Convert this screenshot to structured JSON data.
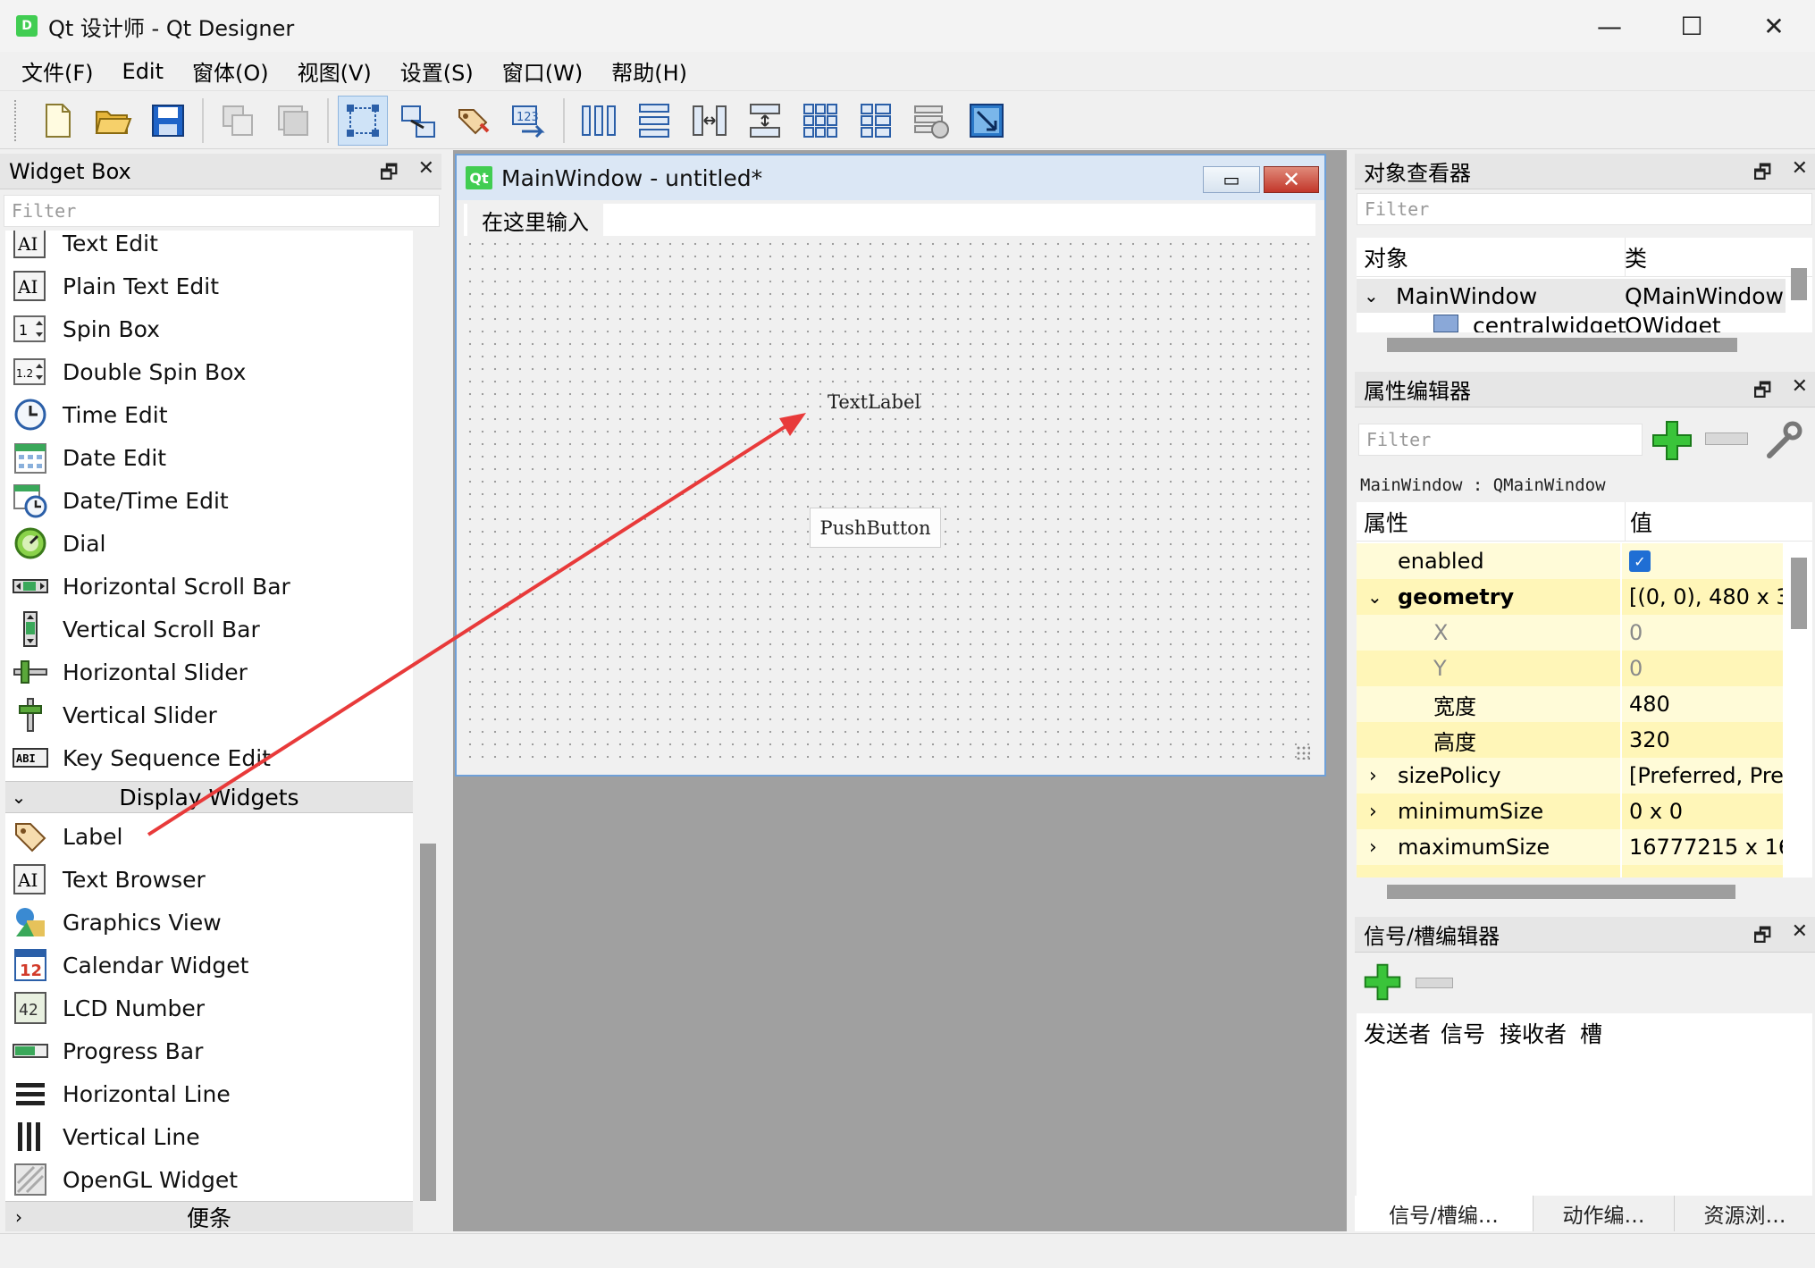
{
  "window": {
    "app_icon_letter": "D",
    "title": "Qt 设计师 - Qt Designer",
    "minimize": "—",
    "maximize": "☐",
    "close": "✕"
  },
  "menu": [
    "文件(F)",
    "Edit",
    "窗体(O)",
    "视图(V)",
    "设置(S)",
    "窗口(W)",
    "帮助(H)"
  ],
  "widget_box": {
    "title": "Widget Box",
    "filter_placeholder": "Filter",
    "items_input": [
      "Text Edit",
      "Plain Text Edit",
      "Spin Box",
      "Double Spin Box",
      "Time Edit",
      "Date Edit",
      "Date/Time Edit",
      "Dial",
      "Horizontal Scroll Bar",
      "Vertical Scroll Bar",
      "Horizontal Slider",
      "Vertical Slider",
      "Key Sequence Edit"
    ],
    "category_display": "Display Widgets",
    "items_display": [
      "Label",
      "Text Browser",
      "Graphics View",
      "Calendar Widget",
      "LCD Number",
      "Progress Bar",
      "Horizontal Line",
      "Vertical Line",
      "OpenGL Widget"
    ],
    "category_next": "便条",
    "icon_labels": {
      "ai": "AI",
      "spin": "1",
      "dspin": "1.2",
      "calendar": "12",
      "lcd": "42",
      "keyseq": "ABI"
    }
  },
  "form_window": {
    "badge": "Qt",
    "title": "MainWindow - untitled*",
    "min_glyph": "▭",
    "close_glyph": "✕",
    "menu_placeholder": "在这里输入",
    "text_label": "TextLabel",
    "push_button": "PushButton"
  },
  "object_inspector": {
    "title": "对象查看器",
    "filter_placeholder": "Filter",
    "col_object": "对象",
    "col_class": "类",
    "rows": [
      {
        "name": "MainWindow",
        "class": "QMainWindow"
      },
      {
        "name": "centralwidget",
        "class": "QWidget"
      }
    ]
  },
  "property_editor": {
    "title": "属性编辑器",
    "filter_placeholder": "Filter",
    "object_line": "MainWindow : QMainWindow",
    "col_property": "属性",
    "col_value": "值",
    "rows": [
      {
        "name": "enabled",
        "value": ""
      },
      {
        "name": "geometry",
        "value": "[(0, 0), 480 x 3..."
      },
      {
        "name": "X",
        "value": "0"
      },
      {
        "name": "Y",
        "value": "0"
      },
      {
        "name": "宽度",
        "value": "480"
      },
      {
        "name": "高度",
        "value": "320"
      },
      {
        "name": "sizePolicy",
        "value": "[Preferred, Pre..."
      },
      {
        "name": "minimumSize",
        "value": "0 x 0"
      },
      {
        "name": "maximumSize",
        "value": "16777215 x 16..."
      }
    ],
    "check_glyph": "✓"
  },
  "signal_slot_editor": {
    "title": "信号/槽编辑器",
    "columns": [
      "发送者",
      "信号",
      "接收者",
      "槽"
    ]
  },
  "bottom_tabs": [
    "信号/槽编…",
    "动作编…",
    "资源浏…"
  ],
  "dock_glyphs": {
    "float": "🗗",
    "close": "✕"
  },
  "colors": {
    "accent": "#41cd52",
    "selection": "#cfe3f7",
    "property_yellow": "#fff6b8",
    "arrow": "#e83a3a"
  }
}
